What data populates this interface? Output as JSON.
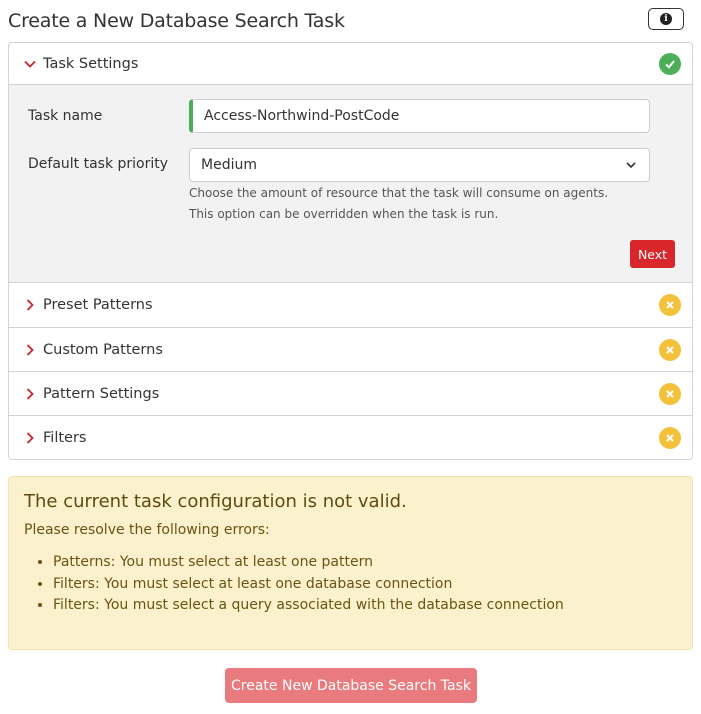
{
  "page": {
    "title": "Create a New Database Search Task",
    "info_icon_glyph": "i"
  },
  "accordion": {
    "sections": [
      {
        "label": "Task Settings",
        "state": "expanded",
        "status": "valid",
        "status_icon": "check-icon"
      },
      {
        "label": "Preset Patterns",
        "state": "collapsed",
        "status": "invalid",
        "status_icon": "x-icon"
      },
      {
        "label": "Custom Patterns",
        "state": "collapsed",
        "status": "invalid",
        "status_icon": "x-icon"
      },
      {
        "label": "Pattern Settings",
        "state": "collapsed",
        "status": "invalid",
        "status_icon": "x-icon"
      },
      {
        "label": "Filters",
        "state": "collapsed",
        "status": "invalid",
        "status_icon": "x-icon"
      }
    ]
  },
  "task_settings": {
    "task_name_label": "Task name",
    "task_name_value": "Access-Northwind-PostCode",
    "priority_label": "Default task priority",
    "priority_value": "Medium",
    "priority_help": "Choose the amount of resource that the task will consume on agents. This option can be overridden when the task is run.",
    "next_label": "Next"
  },
  "alert": {
    "title": "The current task configuration is not valid.",
    "subtitle": "Please resolve the following errors:",
    "errors": [
      "Patterns: You must select at least one pattern",
      "Filters: You must select at least one database connection",
      "Filters: You must select a query associated with the database connection"
    ]
  },
  "footer": {
    "create_label": "Create New Database Search Task"
  },
  "colors": {
    "accent_red": "#d9262b",
    "success_green": "#4cae57",
    "warning_yellow": "#f3c13a",
    "alert_bg": "#fcf1cd",
    "create_button": "#e97a7d"
  }
}
